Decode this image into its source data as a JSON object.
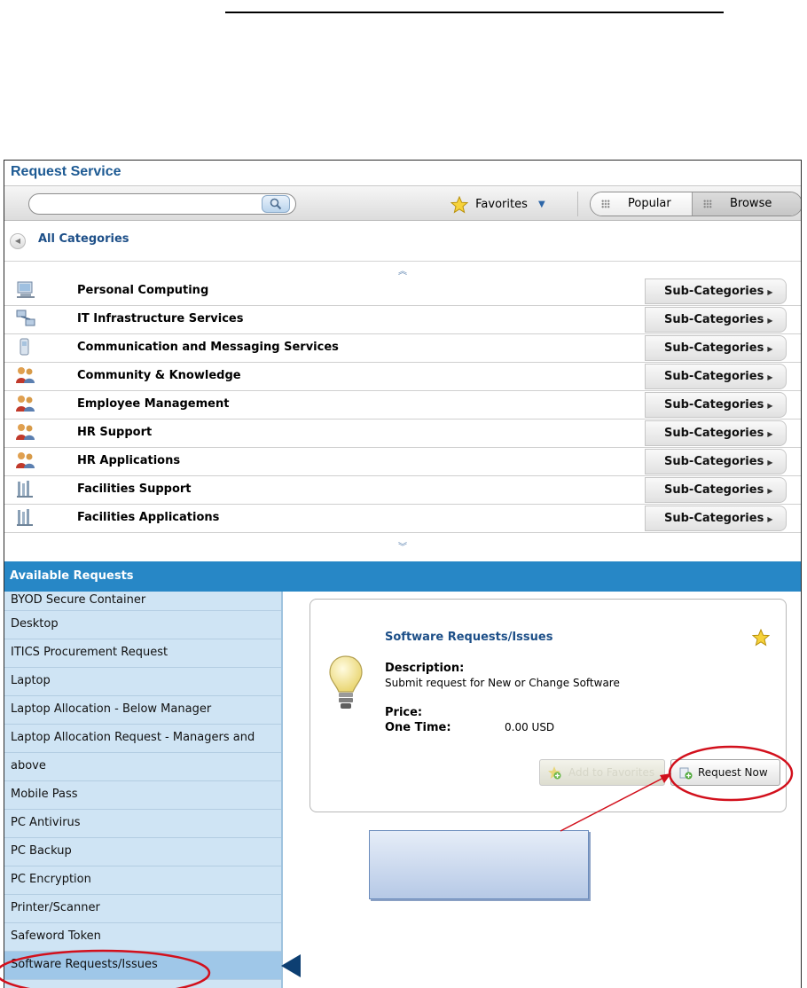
{
  "panel": {
    "title": "Request Service"
  },
  "toolbar": {
    "search_value": "",
    "favorites_label": "Favorites",
    "popular_label": "Popular",
    "browse_label": "Browse"
  },
  "breadcrumb": {
    "all_categories": "All Categories"
  },
  "categories": [
    {
      "label": "Personal Computing",
      "icon": "computer-icon",
      "subcat_label": "Sub-Categories"
    },
    {
      "label": "IT Infrastructure Services",
      "icon": "network-icon",
      "subcat_label": "Sub-Categories"
    },
    {
      "label": "Communication and Messaging Services",
      "icon": "phone-icon",
      "subcat_label": "Sub-Categories"
    },
    {
      "label": "Community & Knowledge",
      "icon": "people-icon",
      "subcat_label": "Sub-Categories"
    },
    {
      "label": "Employee Management",
      "icon": "people-icon",
      "subcat_label": "Sub-Categories"
    },
    {
      "label": "HR Support",
      "icon": "people-icon",
      "subcat_label": "Sub-Categories"
    },
    {
      "label": "HR Applications",
      "icon": "people-icon",
      "subcat_label": "Sub-Categories"
    },
    {
      "label": "Facilities Support",
      "icon": "building-icon",
      "subcat_label": "Sub-Categories"
    },
    {
      "label": "Facilities Applications",
      "icon": "building-icon",
      "subcat_label": "Sub-Categories"
    }
  ],
  "available": {
    "header": "Available Requests",
    "items": [
      "BYOD Secure Container",
      "Desktop",
      "ITICS Procurement Request",
      "Laptop",
      "Laptop Allocation - Below Manager",
      "Laptop Allocation Request - Managers and",
      "above",
      "Mobile Pass",
      "PC Antivirus",
      "PC Backup",
      "PC Encryption",
      "Printer/Scanner",
      "Safeword Token",
      "Software Requests/Issues"
    ],
    "selected": "Software Requests/Issues"
  },
  "detail": {
    "title": "Software Requests/Issues",
    "description_label": "Description:",
    "description": "Submit request for New or Change Software",
    "price_label": "Price:",
    "one_time_label": "One Time:",
    "one_time_value": "0.00 USD",
    "add_favorites_label": "Add to Favorites",
    "request_now_label": "Request Now"
  },
  "colors": {
    "title_blue": "#1d5a93",
    "header_blue": "#2787c6",
    "list_bg": "#cfe4f4",
    "annotation_red": "#d2101c"
  }
}
